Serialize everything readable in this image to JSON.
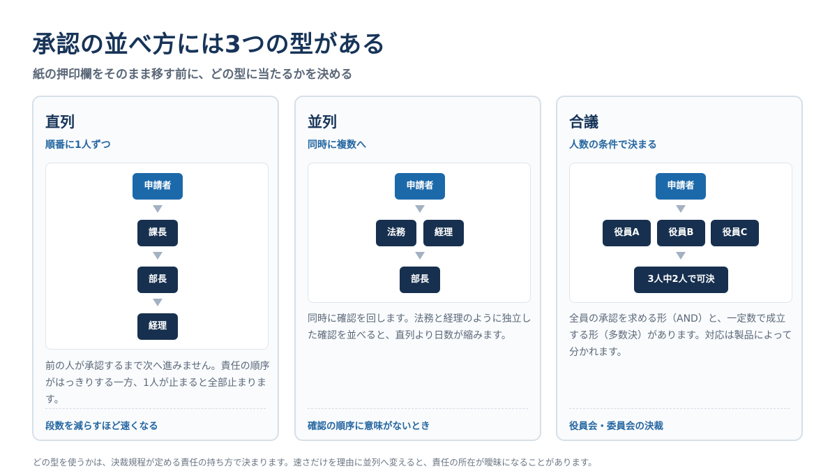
{
  "header": {
    "title": "承認の並べ方には3つの型がある",
    "subtitle": "紙の押印欄をそのまま移す前に、どの型に当たるかを決める"
  },
  "cards": [
    {
      "title": "直列",
      "subtitle": "順番に1人ずつ",
      "nodes": [
        "申請者",
        "課長",
        "部長",
        "経理"
      ],
      "description": "前の人が承認するまで次へ進みません。責任の順序がはっきりする一方、1人が止まると全部止まります。",
      "footer": "段数を減らすほど速くなる"
    },
    {
      "title": "並列",
      "subtitle": "同時に複数へ",
      "nodes": [
        "申請者",
        "法務",
        "経理",
        "部長"
      ],
      "description": "同時に確認を回します。法務と経理のように独立した確認を並べると、直列より日数が縮みます。",
      "footer": "確認の順序に意味がないとき"
    },
    {
      "title": "合議",
      "subtitle": "人数の条件で決まる",
      "nodes": [
        "申請者",
        "役員A",
        "役員B",
        "役員C",
        "3人中2人で可決"
      ],
      "description": "全員の承認を求める形（AND）と、一定数で成立する形（多数決）があります。対応は製品によって分かれます。",
      "footer": "役員会・委員会の決裁"
    }
  ],
  "footnote": "どの型を使うかは、決裁規程が定める責任の持ち方で決まります。速さだけを理由に並列へ変えると、責任の所在が曖昧になることがあります。",
  "colors": {
    "title": "#173458",
    "accent": "#2566a0",
    "node_dark": "#17304f",
    "node_start": "#1c69aa",
    "arrow": "#a3b1c1",
    "card_border": "#d7dfe8"
  }
}
